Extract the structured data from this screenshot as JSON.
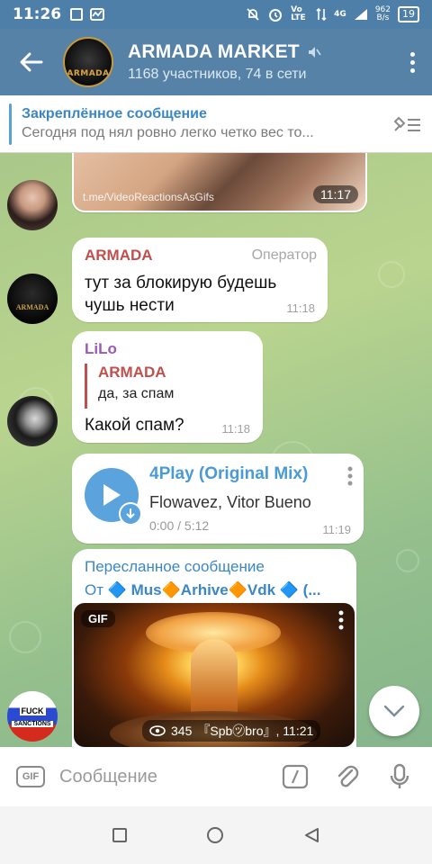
{
  "status_bar": {
    "time": "11:26",
    "net_speed_top": "962",
    "net_speed_bottom": "B/s",
    "signal_label": "4G",
    "volte": "Vo LTE",
    "battery": "19"
  },
  "header": {
    "title": "ARMADA MARKET",
    "avatar_text": "ARMADA",
    "subtitle": "1168 участников, 74 в сети"
  },
  "pinned": {
    "title": "Закреплённое сообщение",
    "text": "Сегодня под нял ровно легко четко вес то..."
  },
  "messages": {
    "media": {
      "source": "t.me/VideoReactionsAsGifs",
      "time": "11:17"
    },
    "armada_msg": {
      "sender": "ARMADA",
      "role": "Оператор",
      "text_line1": "тут за блокирую будешь",
      "text_line2": "чушь нести",
      "time": "11:18",
      "avatar_text": "ARMADA"
    },
    "lilo_msg": {
      "sender": "LiLo",
      "reply_sender": "ARMADA",
      "reply_text": "да, за спам",
      "text": "Какой спам?",
      "time": "11:18"
    },
    "audio_msg": {
      "title": "4Play (Original Mix)",
      "artist": "Flowavez, Vitor Bueno",
      "duration": "0:00 / 5:12",
      "time": "11:19"
    },
    "forwarded_msg": {
      "label": "Пересланное сообщение",
      "from_prefix": "От",
      "from_name": "🔷 Mus🔶Arhive🔶Vdk 🔷 (...",
      "gif_badge": "GIF",
      "views": "345",
      "author": "『Spb㋡bro』, 11:21",
      "avatar_line1": "FUCK",
      "avatar_line2": "SANCTIONS"
    }
  },
  "input": {
    "gif_label": "GIF",
    "placeholder": "Сообщение"
  },
  "colors": {
    "header": "#5682a8",
    "accent_blue": "#3b87c4",
    "armada_red": "#c0504d",
    "lilo_purple": "#9b59b6"
  }
}
